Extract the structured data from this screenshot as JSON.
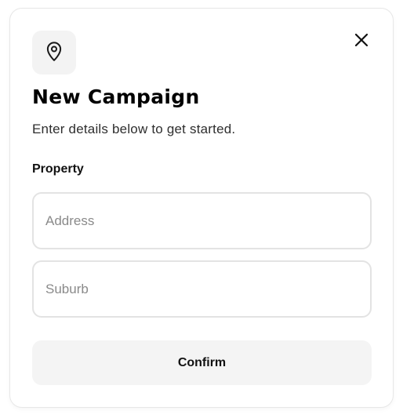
{
  "modal": {
    "icon": "map-pin-icon",
    "close_icon": "close-icon",
    "title": "New Campaign",
    "subtitle": "Enter details below to get started.",
    "section_label": "Property",
    "address": {
      "placeholder": "Address",
      "value": ""
    },
    "suburb": {
      "placeholder": "Suburb",
      "value": ""
    },
    "confirm_label": "Confirm"
  },
  "colors": {
    "title": "#000000",
    "input_border": "#e3e3e3",
    "button_bg": "#f4f4f4",
    "icon_tile_bg": "#f3f3f3"
  }
}
